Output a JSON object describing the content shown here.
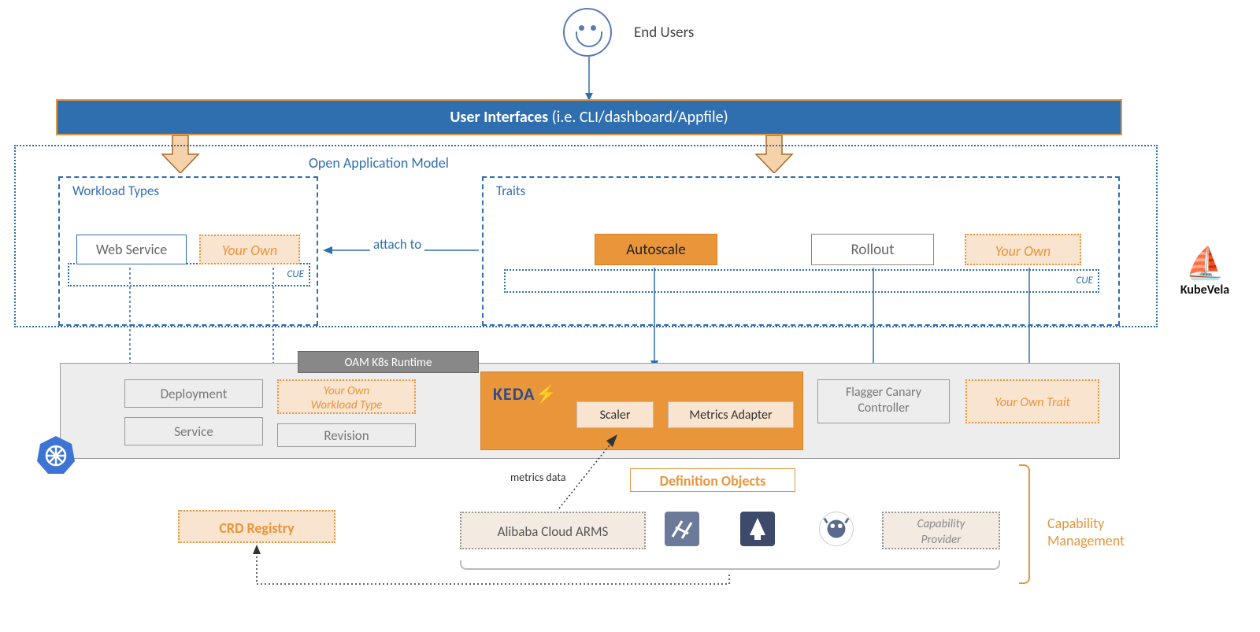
{
  "end_users": "End Users",
  "user_interfaces": {
    "bold": "User Interfaces",
    "rest": " (i.e. CLI/dashboard/Appfile)"
  },
  "oam": {
    "label": "Open Application Model",
    "workload_types": {
      "title": "Workload Types",
      "cue": "CUE",
      "web_service": "Web Service",
      "your_own": "Your Own"
    },
    "traits": {
      "title": "Traits",
      "cue": "CUE",
      "autoscale": "Autoscale",
      "rollout": "Rollout",
      "your_own": "Your Own"
    },
    "attach_to": "attach to"
  },
  "runtime": {
    "label": "OAM K8s Runtime",
    "deployment": "Deployment",
    "service": "Service",
    "your_own_workload_type_l1": "Your Own",
    "your_own_workload_type_l2": "Workload Type",
    "revision": "Revision",
    "keda": "KEDA",
    "scaler": "Scaler",
    "metrics_adapter": "Metrics Adapter",
    "flagger_l1": "Flagger Canary",
    "flagger_l2": "Controller",
    "your_own_trait": "Your Own Trait"
  },
  "def_objects": "Definition Objects",
  "metrics_data": "metrics data",
  "providers": {
    "arms": "Alibaba Cloud ARMS",
    "cap_provider_l1": "Capability",
    "cap_provider_l2": "Provider"
  },
  "crd_registry": "CRD Registry",
  "cap_mgmt_l1": "Capability",
  "cap_mgmt_l2": "Management",
  "kubevela": "KubeVela"
}
